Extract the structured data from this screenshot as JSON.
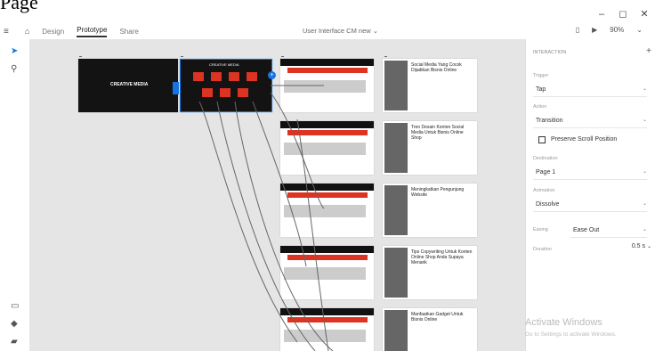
{
  "page_label": "Page",
  "window": {
    "minimize": "–",
    "maximize": "◻",
    "close": "✕"
  },
  "menubar": {
    "home_icon": "home-icon",
    "tabs": [
      {
        "label": "Design"
      },
      {
        "label": "Prototype"
      },
      {
        "label": "Share"
      }
    ],
    "doc_title": "User Interface CM new",
    "zoom": "90%"
  },
  "panel": {
    "header": "INTERACTION",
    "trigger_label": "Trigger",
    "trigger_value": "Tap",
    "action_label": "Action",
    "action_value": "Transition",
    "preserve_scroll": "Preserve Scroll Position",
    "destination_label": "Destination",
    "destination_value": "Page 1",
    "animation_label": "Animation",
    "animation_value": "Dissolve",
    "easing_label": "Easing",
    "easing_value": "Ease Out",
    "duration_label": "Duration",
    "duration_value": "0.5 s"
  },
  "articles": [
    {
      "title": "Social Media Yang Cocok Dijadikan Bisnis Online"
    },
    {
      "title": "Tren Desain Konten Social Media Untuk Bisnis Online Shop"
    },
    {
      "title": "Meningkatkan Pengunjung Website"
    },
    {
      "title": "Tips Copywriting Untuk Konten Online Shop Anda Supaya Menarik"
    },
    {
      "title": "Manfaatkan Gadget Untuk Bisnis Online"
    }
  ],
  "brand": "CREATIVE MEDIA",
  "watermark": {
    "line1": "Activate Windows",
    "line2": "Go to Settings to activate Windows."
  }
}
